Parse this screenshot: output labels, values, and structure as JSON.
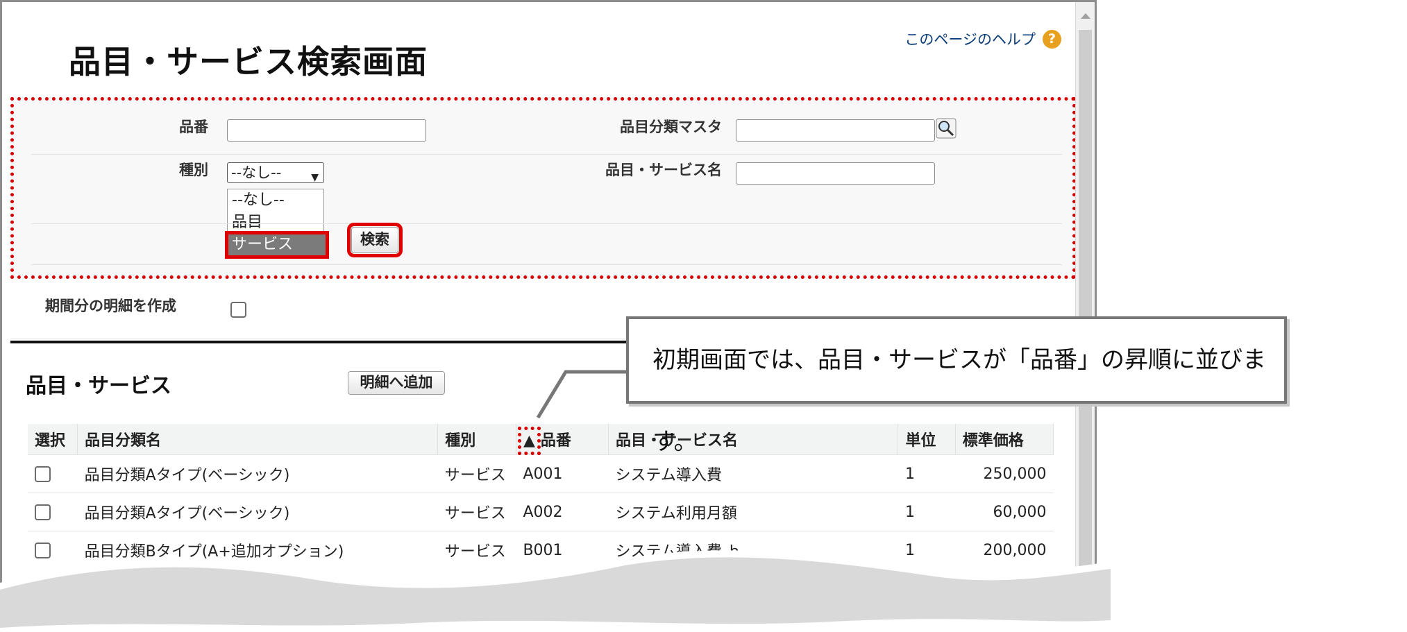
{
  "page": {
    "title": "品目・サービス検索画面",
    "help_label": "このページのヘルプ",
    "help_icon": "?"
  },
  "search": {
    "item_no_label": "品番",
    "category_master_label": "品目分類マスタ",
    "type_label": "種別",
    "type_selected": "--なし--",
    "type_options": [
      "--なし--",
      "品目",
      "サービス"
    ],
    "item_name_label": "品目・サービス名",
    "search_button": "検索"
  },
  "period": {
    "label": "期間分の明細を作成"
  },
  "results": {
    "section_title": "品目・サービス",
    "add_button": "明細へ追加",
    "sort_marker": "▲",
    "columns": [
      "選択",
      "品目分類名",
      "種別",
      "品番",
      "品目・サービス名",
      "単位",
      "標準価格"
    ],
    "rows": [
      {
        "category": "品目分類Aタイプ(ベーシック)",
        "type": "サービス",
        "item_no": "A001",
        "name": "システム導入費",
        "unit": "1",
        "price": "250,000"
      },
      {
        "category": "品目分類Aタイプ(ベーシック)",
        "type": "サービス",
        "item_no": "A002",
        "name": "システム利用月額",
        "unit": "1",
        "price": "60,000"
      },
      {
        "category": "品目分類Bタイプ(A+追加オプション)",
        "type": "サービス",
        "item_no": "B001",
        "name": "システム導入費_b",
        "unit": "1",
        "price": "200,000"
      }
    ]
  },
  "callout": {
    "text": "初期画面では、品目・サービスが「品番」の昇順に並びます。"
  },
  "colors": {
    "highlight_red": "#d80000",
    "help_icon": "#e7a11f",
    "link_blue": "#0b3d78"
  }
}
